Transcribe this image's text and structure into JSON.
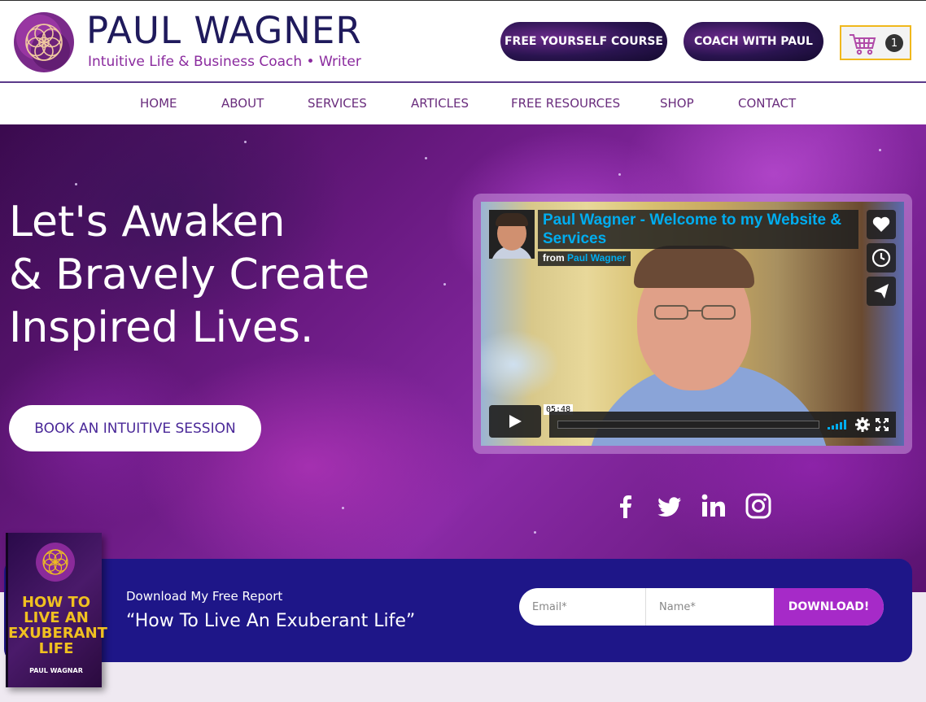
{
  "header": {
    "brand_name": "PAUL WAGNER",
    "brand_tagline": "Intuitive Life & Business Coach • Writer",
    "free_course_label": "FREE YOURSELF COURSE",
    "coach_label": "COACH WITH PAUL",
    "cart_count": "1",
    "icons": {
      "logo": "mandala-logo-icon",
      "cart": "shopping-cart-icon"
    }
  },
  "nav": {
    "items": [
      {
        "label": "HOME"
      },
      {
        "label": "ABOUT"
      },
      {
        "label": "SERVICES"
      },
      {
        "label": "ARTICLES"
      },
      {
        "label": "FREE RESOURCES"
      },
      {
        "label": "SHOP"
      },
      {
        "label": "CONTACT"
      }
    ]
  },
  "hero": {
    "headline_lines": [
      "Let's Awaken",
      "& Bravely Create",
      "Inspired Lives."
    ],
    "cta_label": "BOOK AN INTUITIVE SESSION"
  },
  "video": {
    "title": "Paul Wagner - Welcome to my Website & Services",
    "from_prefix": "from",
    "from_author": "Paul Wagner",
    "duration": "05:48",
    "side_icons": [
      "heart-icon",
      "clock-icon",
      "send-icon"
    ],
    "control_icons": [
      "play-icon",
      "volume-icon",
      "settings-icon",
      "fullscreen-icon"
    ]
  },
  "social": {
    "icons": [
      "facebook-icon",
      "twitter-icon",
      "linkedin-icon",
      "instagram-icon"
    ]
  },
  "download": {
    "label": "Download My Free Report",
    "title": "“How To Live An Exuberant Life”",
    "email_placeholder": "Email*",
    "name_placeholder": "Name*",
    "button_label": "DOWNLOAD!"
  },
  "book": {
    "title": "HOW TO LIVE AN EXUBERANT LIFE",
    "author": "PAUL WAGNAR"
  },
  "colors": {
    "brand_navy": "#1f1a5c",
    "brand_purple": "#8a2a9e",
    "band_blue": "#1e1688",
    "download_button": "#a62ac8",
    "video_title_blue": "#00adef",
    "cart_border": "#f0b81c"
  }
}
